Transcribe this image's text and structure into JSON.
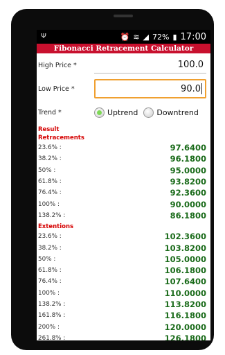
{
  "status": {
    "battery": "72%",
    "time": "17:00",
    "usb": "Ψ"
  },
  "app": {
    "title": "Fibonacci Retracement Calculator"
  },
  "inputs": {
    "high_label": "High Price *",
    "high_value": "100.0",
    "low_label": "Low Price *",
    "low_value": "90.0"
  },
  "trend": {
    "label": "Trend *",
    "options": [
      "Uptrend",
      "Downtrend"
    ],
    "selected": "Uptrend"
  },
  "result_title": "Result",
  "retracements": {
    "title": "Retracements",
    "rows": [
      {
        "k": "23.6% :",
        "v": "97.6400"
      },
      {
        "k": "38.2% :",
        "v": "96.1800"
      },
      {
        "k": "50% :",
        "v": "95.0000"
      },
      {
        "k": "61.8% :",
        "v": "93.8200"
      },
      {
        "k": "76.4% :",
        "v": "92.3600"
      },
      {
        "k": "100% :",
        "v": "90.0000"
      },
      {
        "k": "138.2% :",
        "v": "86.1800"
      }
    ]
  },
  "extensions": {
    "title": "Extentions",
    "rows": [
      {
        "k": "23.6% :",
        "v": "102.3600"
      },
      {
        "k": "38.2% :",
        "v": "103.8200"
      },
      {
        "k": "50% :",
        "v": "105.0000"
      },
      {
        "k": "61.8% :",
        "v": "106.1800"
      },
      {
        "k": "76.4% :",
        "v": "107.6400"
      },
      {
        "k": "100% :",
        "v": "110.0000"
      },
      {
        "k": "138.2% :",
        "v": "113.8200"
      },
      {
        "k": "161.8% :",
        "v": "116.1800"
      },
      {
        "k": "200% :",
        "v": "120.0000"
      },
      {
        "k": "261.8% :",
        "v": "126.1800"
      }
    ]
  }
}
